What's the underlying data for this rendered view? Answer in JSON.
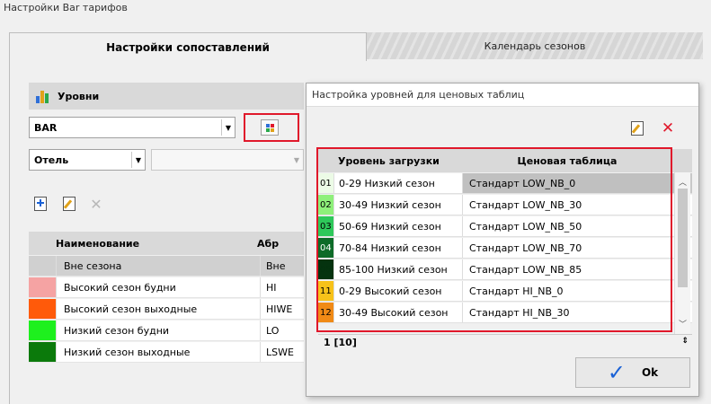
{
  "window": {
    "title": "Настройки Bar тарифов"
  },
  "tabs": [
    {
      "label": "Настройки сопоставлений"
    },
    {
      "label": "Календарь сезонов"
    }
  ],
  "levels_section": {
    "title": "Уровни",
    "icon": "bar-chart-icon"
  },
  "bar_select": {
    "value": "BAR"
  },
  "hotel_select": {
    "value": "Отель",
    "second_value": ""
  },
  "left_grid": {
    "columns": [
      "Наименование",
      "Абр"
    ],
    "rows": [
      {
        "name": "Вне сезона",
        "abbr": "Вне",
        "color": ""
      },
      {
        "name": "Высокий сезон будни",
        "abbr": "HI",
        "color": "#f5a3a3"
      },
      {
        "name": "Высокий сезон выходные",
        "abbr": "HIWE",
        "color": "#ff5a0a"
      },
      {
        "name": "Низкий сезон будни",
        "abbr": "LO",
        "color": "#1ef01e"
      },
      {
        "name": "Низкий сезон выходные",
        "abbr": "LSWE",
        "color": "#0b7a0b"
      }
    ]
  },
  "dialog": {
    "title": "Настройка уровней для ценовых таблиц",
    "columns": [
      "Уровень загрузки",
      "Ценовая таблица"
    ],
    "rows": [
      {
        "code": "01",
        "level": "0-29 Низкий сезон",
        "table": "Стандарт LOW_NB_0",
        "color": "#ecfbe6"
      },
      {
        "code": "02",
        "level": "30-49 Низкий сезон",
        "table": "Стандарт LOW_NB_30",
        "color": "#8ef07a"
      },
      {
        "code": "03",
        "level": "50-69 Низкий сезон",
        "table": "Стандарт LOW_NB_50",
        "color": "#2ec85a"
      },
      {
        "code": "04",
        "level": "70-84 Низкий сезон",
        "table": "Стандарт LOW_NB_70",
        "color": "#0d6b28"
      },
      {
        "code": "05",
        "level": "85-100 Низкий сезон",
        "table": "Стандарт LOW_NB_85",
        "color": "#05330f"
      },
      {
        "code": "11",
        "level": "0-29 Высокий сезон",
        "table": "Стандарт HI_NB_0",
        "color": "#f7c21a"
      },
      {
        "code": "12",
        "level": "30-49 Высокий сезон",
        "table": "Стандарт HI_NB_30",
        "color": "#f08a16"
      }
    ],
    "footer": "1 [10]",
    "ok_label": "Ok"
  },
  "colors": {
    "accent_red": "#e0182b",
    "check_blue": "#1a62d6"
  }
}
